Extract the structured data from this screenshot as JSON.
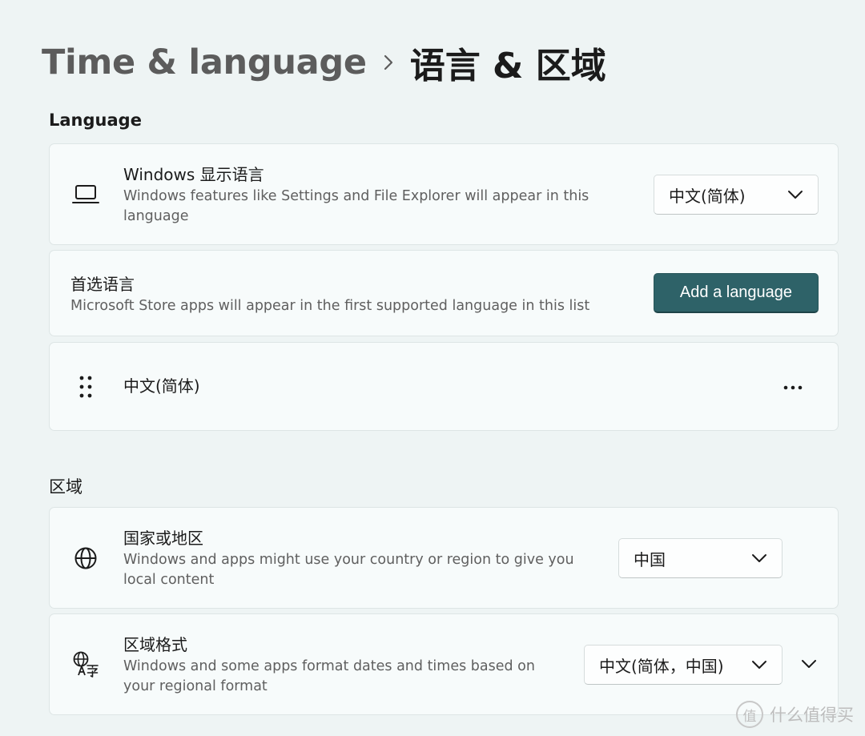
{
  "breadcrumb": {
    "parent": "Time & language",
    "current": "语言 & 区域"
  },
  "language_section": {
    "title": "Language",
    "display_language": {
      "title": "Windows 显示语言",
      "description_line1": "Windows features like Settings and File Explorer will appear in this",
      "description_line2": "language",
      "icon": "laptop-icon",
      "selected": "中文(简体)"
    },
    "preferred": {
      "title": "首选语言",
      "description": "Microsoft Store apps will appear in the first supported language in this list",
      "button_label": "Add a language"
    },
    "languages": [
      {
        "name": "中文(简体)",
        "icon": "drag-handle-icon"
      }
    ]
  },
  "region_section": {
    "title": "区域",
    "country": {
      "title": "国家或地区",
      "description_line1": "Windows and apps might use your country or region to give you",
      "description_line2": "local content",
      "icon": "globe-icon",
      "selected": "中国"
    },
    "format": {
      "title": "区域格式",
      "description_line1": "Windows and some apps format dates and times based on",
      "description_line2": "your regional format",
      "icon": "language-format-icon",
      "selected": "中文(简体，中国)"
    }
  },
  "watermark": {
    "glyph": "值",
    "text": "什么值得买"
  },
  "colors": {
    "accent": "#2e6268",
    "background": "#eef4f4",
    "card": "#f7fbfb"
  }
}
